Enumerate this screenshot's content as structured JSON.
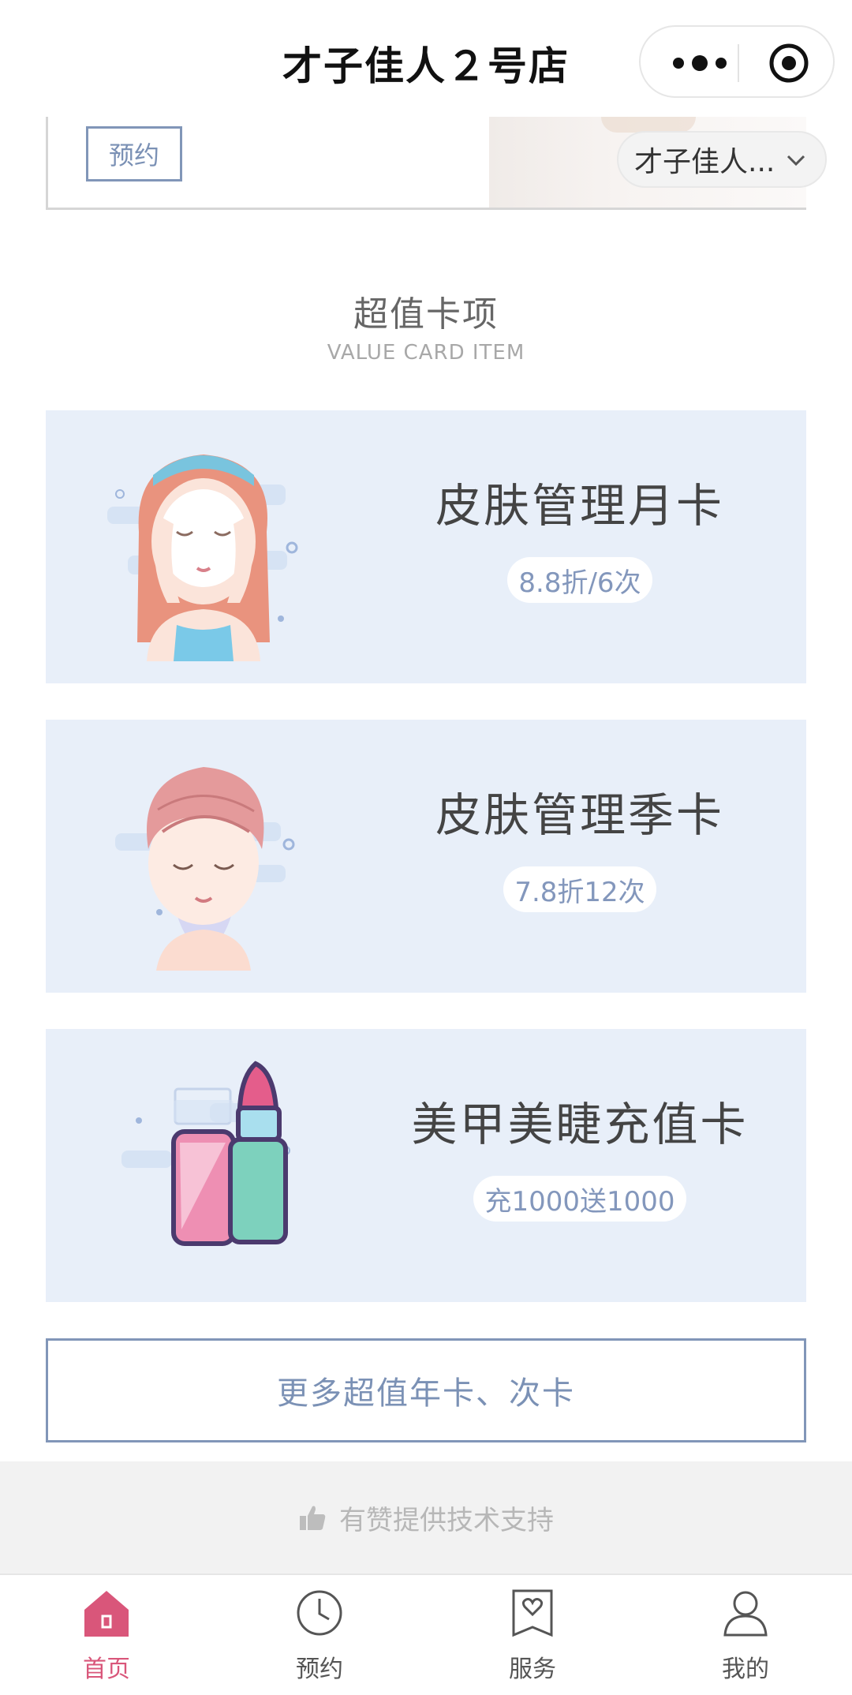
{
  "header": {
    "title": "才子佳人２号店"
  },
  "banner": {
    "reserve_label": "预约",
    "store_select_value": "才子佳人..."
  },
  "section": {
    "title": "超值卡项",
    "subtitle": "VALUE CARD ITEM"
  },
  "cards": [
    {
      "name": "皮肤管理月卡",
      "badge": "8.8折/6次",
      "illustration": "face-mask-girl-illustration"
    },
    {
      "name": "皮肤管理季卡",
      "badge": "7.8折12次",
      "illustration": "towel-wrap-girl-illustration"
    },
    {
      "name": "美甲美睫充值卡",
      "badge": "充1000送1000",
      "illustration": "cosmetics-lipstick-illustration"
    }
  ],
  "more_button": {
    "label": "更多超值年卡、次卡"
  },
  "support": {
    "text": "有赞提供技术支持",
    "icon": "thumbs-up-icon"
  },
  "tabbar": {
    "items": [
      {
        "label": "首页",
        "icon": "home-icon",
        "active": true
      },
      {
        "label": "预约",
        "icon": "clock-icon",
        "active": false
      },
      {
        "label": "服务",
        "icon": "heart-bookmark-icon",
        "active": false
      },
      {
        "label": "我的",
        "icon": "user-icon",
        "active": false
      }
    ]
  },
  "colors": {
    "accent": "#d9567a",
    "card_bg": "#e8eff9",
    "outline_blue": "#8196b8"
  }
}
